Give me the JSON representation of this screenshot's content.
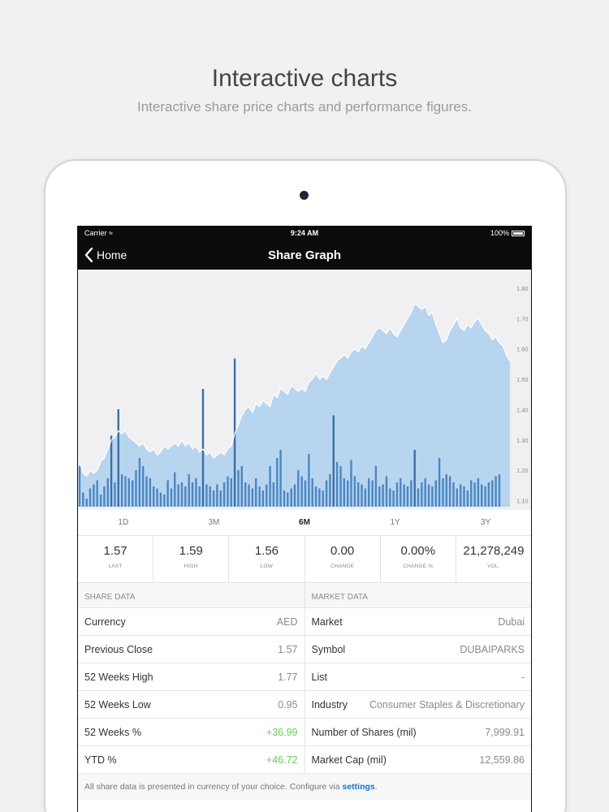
{
  "promo": {
    "title": "Interactive charts",
    "subtitle": "Interactive share price charts and performance figures."
  },
  "status_bar": {
    "carrier": "Carrier",
    "time": "9:24 AM",
    "battery": "100%"
  },
  "nav": {
    "back_label": "Home",
    "title": "Share Graph"
  },
  "chart_data": {
    "type": "area",
    "y_ticks": [
      "1.80",
      "1.70",
      "1.60",
      "1.50",
      "1.40",
      "1.30",
      "1.20",
      "1.10"
    ],
    "ylim": [
      1.08,
      1.84
    ],
    "price": [
      1.23,
      1.19,
      1.18,
      1.2,
      1.19,
      1.2,
      1.23,
      1.24,
      1.27,
      1.3,
      1.31,
      1.33,
      1.32,
      1.33,
      1.31,
      1.3,
      1.29,
      1.28,
      1.29,
      1.27,
      1.26,
      1.27,
      1.25,
      1.26,
      1.28,
      1.27,
      1.28,
      1.29,
      1.28,
      1.3,
      1.28,
      1.29,
      1.27,
      1.28,
      1.26,
      1.27,
      1.25,
      1.26,
      1.24,
      1.25,
      1.26,
      1.25,
      1.27,
      1.28,
      1.32,
      1.35,
      1.38,
      1.4,
      1.41,
      1.39,
      1.42,
      1.41,
      1.43,
      1.42,
      1.41,
      1.45,
      1.44,
      1.47,
      1.46,
      1.45,
      1.48,
      1.47,
      1.46,
      1.47,
      1.46,
      1.49,
      1.5,
      1.52,
      1.5,
      1.51,
      1.5,
      1.52,
      1.54,
      1.56,
      1.57,
      1.58,
      1.57,
      1.59,
      1.6,
      1.59,
      1.61,
      1.6,
      1.62,
      1.64,
      1.66,
      1.67,
      1.66,
      1.65,
      1.67,
      1.65,
      1.64,
      1.66,
      1.68,
      1.7,
      1.72,
      1.75,
      1.74,
      1.73,
      1.74,
      1.71,
      1.72,
      1.68,
      1.65,
      1.62,
      1.63,
      1.66,
      1.68,
      1.7,
      1.67,
      1.66,
      1.68,
      1.67,
      1.69,
      1.7,
      1.68,
      1.66,
      1.65,
      1.63,
      1.64,
      1.62,
      1.61,
      1.58,
      1.56
    ],
    "volume": [
      20,
      7,
      4,
      9,
      11,
      13,
      6,
      10,
      14,
      18,
      12,
      9,
      16,
      15,
      14,
      13,
      18,
      24,
      20,
      15,
      14,
      10,
      9,
      7,
      6,
      13,
      9,
      17,
      11,
      12,
      10,
      16,
      12,
      14,
      10,
      9,
      11,
      10,
      8,
      11,
      8,
      12,
      15,
      14,
      32,
      18,
      20,
      12,
      11,
      9,
      14,
      10,
      8,
      11,
      20,
      12,
      24,
      28,
      8,
      7,
      9,
      11,
      18,
      15,
      13,
      26,
      14,
      10,
      9,
      8,
      13,
      16,
      18,
      22,
      20,
      14,
      13,
      23,
      15,
      12,
      11,
      9,
      14,
      13,
      20,
      10,
      11,
      15,
      9,
      8,
      12,
      14,
      11,
      10,
      13,
      18,
      9,
      12,
      14,
      11,
      10,
      13,
      24,
      14,
      16,
      15,
      12,
      9,
      11,
      10,
      8,
      13,
      12,
      14,
      11,
      10,
      12,
      13,
      15,
      16
    ],
    "highlight_volume": {
      "9": 35,
      "11": 48,
      "35": 58,
      "44": 73,
      "72": 45,
      "95": 28
    }
  },
  "ranges": [
    {
      "label": "1D",
      "active": false
    },
    {
      "label": "3M",
      "active": false
    },
    {
      "label": "6M",
      "active": true
    },
    {
      "label": "1Y",
      "active": false
    },
    {
      "label": "3Y",
      "active": false
    }
  ],
  "stats": [
    {
      "value": "1.57",
      "label": "Last"
    },
    {
      "value": "1.59",
      "label": "High"
    },
    {
      "value": "1.56",
      "label": "Low"
    },
    {
      "value": "0.00",
      "label": "Change"
    },
    {
      "value": "0.00%",
      "label": "Change %"
    },
    {
      "value": "21,278,249",
      "label": "Vol."
    }
  ],
  "share_data": {
    "heading": "Share Data",
    "rows": [
      {
        "key": "Currency",
        "value": "AED",
        "positive": false
      },
      {
        "key": "Previous Close",
        "value": "1.57",
        "positive": false
      },
      {
        "key": "52 Weeks High",
        "value": "1.77",
        "positive": false
      },
      {
        "key": "52 Weeks Low",
        "value": "0.95",
        "positive": false
      },
      {
        "key": "52 Weeks %",
        "value": "+36.99",
        "positive": true
      },
      {
        "key": "YTD %",
        "value": "+46.72",
        "positive": true
      }
    ]
  },
  "market_data": {
    "heading": "Market Data",
    "rows": [
      {
        "key": "Market",
        "value": "Dubai",
        "positive": false
      },
      {
        "key": "Symbol",
        "value": "DUBAIPARKS",
        "positive": false
      },
      {
        "key": "List",
        "value": "-",
        "positive": false
      },
      {
        "key": "Industry",
        "value": "Consumer Staples & Discretionary",
        "positive": false
      },
      {
        "key": "Number of Shares (mil)",
        "value": "7,999.91",
        "positive": false
      },
      {
        "key": "Market Cap (mil)",
        "value": "12,559.86",
        "positive": false
      }
    ]
  },
  "footer": {
    "text": "All share data is presented in currency of your choice. Configure via ",
    "link": "settings",
    "end": "."
  },
  "colors": {
    "area": "#b8d5ef",
    "line": "#ffffff",
    "volume": "#4b86c3",
    "volume_dark": "#3e6ea5"
  }
}
